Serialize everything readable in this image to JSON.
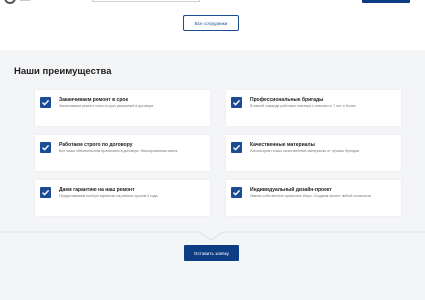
{
  "colors": {
    "accent": "#1a4c93",
    "accent_dark": "#0d3e84",
    "section_bg": "#f4f5f7"
  },
  "staff": {
    "all_staff_label": "Все сотрудники"
  },
  "advantages": {
    "title": "Наши преимущества",
    "items": [
      {
        "icon": "checkbox-icon",
        "title": "Заканчиваем ремонт в срок",
        "desc": "Заканчиваем ремонт точно в срок указанный в договоре"
      },
      {
        "icon": "checkbox-icon",
        "title": "Профессиональные бригады",
        "desc": "В нашей команде работают мастера с опытом от 7 лет и более"
      },
      {
        "icon": "checkbox-icon",
        "title": "Работаем строго по договору",
        "desc": "Все наши обязательства прописаны в договоре. Фиксированная смета"
      },
      {
        "icon": "checkbox-icon",
        "title": "Качественные материалы",
        "desc": "Используем только качественные материалы от лучших брендов"
      },
      {
        "icon": "checkbox-icon",
        "title": "Даем гарантию на наш ремонт",
        "desc": "Предоставляем полную гарантию на ремонт сроком 3 года"
      },
      {
        "icon": "checkbox-icon",
        "title": "Индивидуальный дизайн-проект",
        "desc": "Имеем собственное проектное бюро. Создаем проект любой сложности"
      }
    ],
    "order_label": "Оставить заявку"
  }
}
